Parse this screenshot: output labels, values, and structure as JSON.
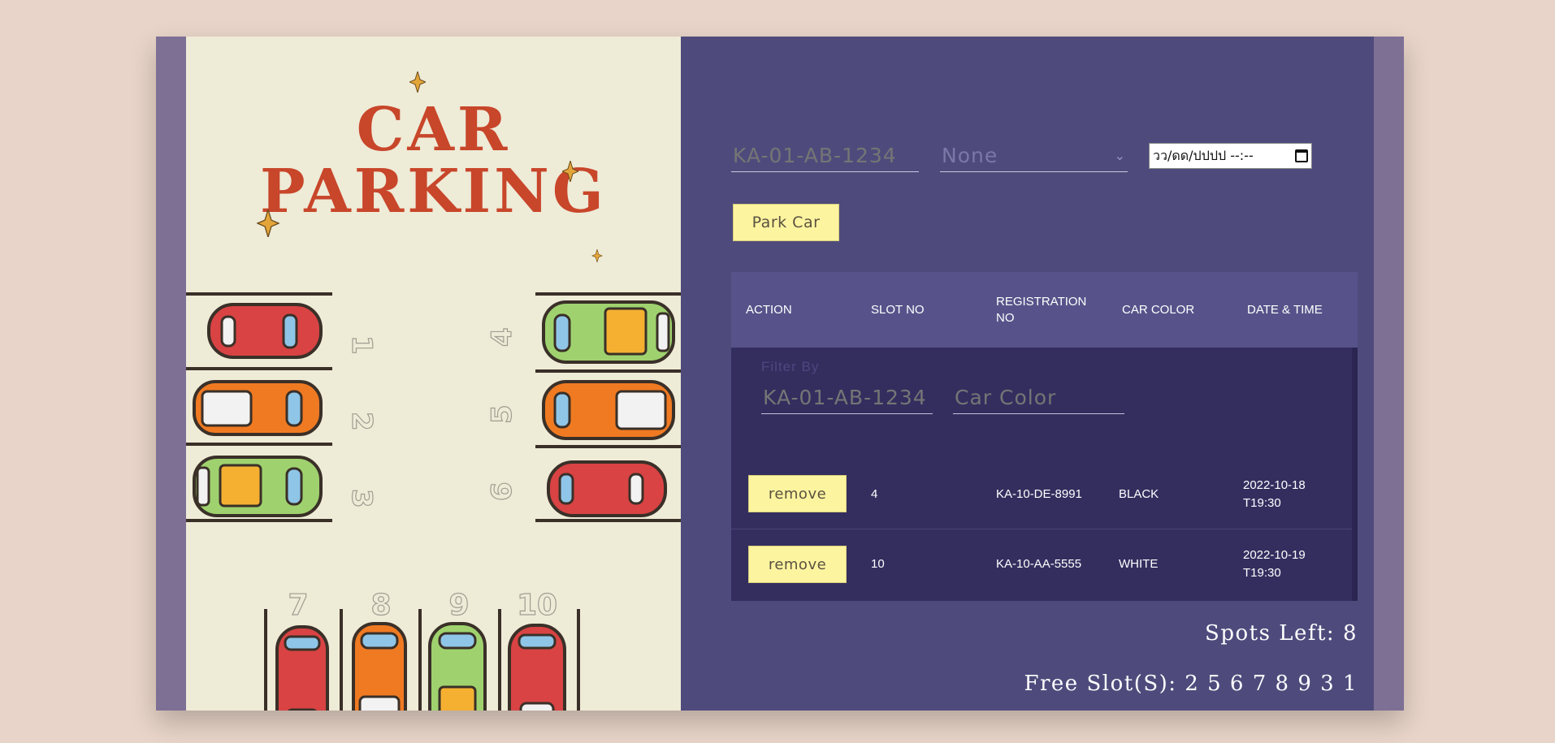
{
  "banner": {
    "title_line1": "CAR",
    "title_line2": "PARKING",
    "slot_labels": [
      "1",
      "2",
      "3",
      "4",
      "5",
      "6",
      "7",
      "8",
      "9",
      "10"
    ],
    "colors": {
      "title": "#c8462a",
      "panel": "#eeebd7",
      "sparkle": "#e3a53a"
    }
  },
  "form": {
    "registration_placeholder": "KA-01-AB-1234",
    "color_select_value": "None",
    "datetime_value": "วว/ดด/ปปปป --:--",
    "park_button_label": "Park Car"
  },
  "table": {
    "headers": {
      "action": "ACTION",
      "slot_no": "SLOT NO",
      "registration_no": "REGISTRATION NO",
      "car_color": "CAR COLOR",
      "date_time": "DATE & TIME"
    },
    "filter": {
      "label": "Filter By",
      "registration_placeholder": "KA-01-AB-1234",
      "color_placeholder": "Car Color"
    },
    "rows": [
      {
        "action_label": "remove",
        "slot": "4",
        "registration": "KA-10-DE-8991",
        "color": "BLACK",
        "datetime": "2022-10-18T19:30"
      },
      {
        "action_label": "remove",
        "slot": "10",
        "registration": "KA-10-AA-5555",
        "color": "WHITE",
        "datetime": "2022-10-19T19:30"
      }
    ]
  },
  "summary": {
    "spots_left": "Spots Left: 8",
    "free_slots": "Free Slot(S): 2 5 6 7 8 9 3 1"
  },
  "theme": {
    "accent_button": "#fdf4a0",
    "panel_bg": "#4e4b7c",
    "table_body": "#342e5f"
  }
}
